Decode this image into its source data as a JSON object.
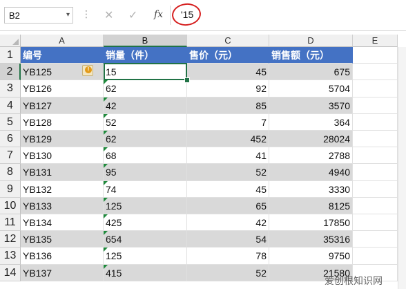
{
  "formula_bar": {
    "name_box": "B2",
    "name_box_arrow": "▾",
    "separator": "⋮",
    "cancel_glyph": "✕",
    "enter_glyph": "✓",
    "fx_label": "fx",
    "value": "'15"
  },
  "columns": [
    "A",
    "B",
    "C",
    "D",
    "E"
  ],
  "rows": [
    "1",
    "2",
    "3",
    "4",
    "5",
    "6",
    "7",
    "8",
    "9",
    "10",
    "11",
    "12",
    "13",
    "14"
  ],
  "headers": [
    "编号",
    "销量（件）",
    "售价（元）",
    "销售额（元）"
  ],
  "data": [
    [
      "YB125",
      "15",
      "45",
      "675"
    ],
    [
      "YB126",
      "62",
      "92",
      "5704"
    ],
    [
      "YB127",
      "42",
      "85",
      "3570"
    ],
    [
      "YB128",
      "52",
      "7",
      "364"
    ],
    [
      "YB129",
      "62",
      "452",
      "28024"
    ],
    [
      "YB130",
      "68",
      "41",
      "2788"
    ],
    [
      "YB131",
      "95",
      "52",
      "4940"
    ],
    [
      "YB132",
      "74",
      "45",
      "3330"
    ],
    [
      "YB133",
      "125",
      "65",
      "8125"
    ],
    [
      "YB134",
      "425",
      "42",
      "17850"
    ],
    [
      "YB135",
      "654",
      "54",
      "35316"
    ],
    [
      "YB136",
      "125",
      "78",
      "9750"
    ],
    [
      "YB137",
      "415",
      "52",
      "21580"
    ]
  ],
  "error_icon_glyph": "!",
  "watermark": "爱创根知识网",
  "colors": {
    "header_fill": "#4472c4",
    "band_fill": "#d9d9d9",
    "selection": "#217346",
    "annotation": "#d62020"
  }
}
